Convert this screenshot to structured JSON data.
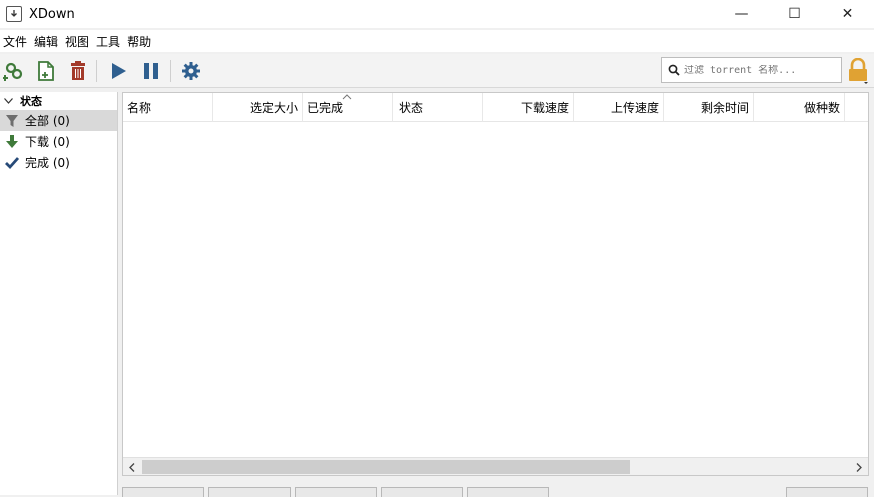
{
  "window": {
    "title": "XDown",
    "minimize": "—",
    "maximize": "☐",
    "close": "✕"
  },
  "menu": [
    "文件",
    "编辑",
    "视图",
    "工具",
    "帮助"
  ],
  "toolbar": {
    "icons": [
      "add-link-icon",
      "add-file-icon",
      "delete-icon",
      "play-icon",
      "pause-icon",
      "settings-icon"
    ]
  },
  "search": {
    "placeholder": "过滤 torrent 名称..."
  },
  "sidebar": {
    "header": "状态",
    "items": [
      {
        "label": "全部 (0)",
        "icon": "filter-icon",
        "selected": true
      },
      {
        "label": "下载 (0)",
        "icon": "download-arrow-icon",
        "selected": false
      },
      {
        "label": "完成 (0)",
        "icon": "checkmark-icon",
        "selected": false
      }
    ]
  },
  "table": {
    "columns": [
      "名称",
      "选定大小",
      "已完成",
      "状态",
      "下载速度",
      "上传速度",
      "剩余时间",
      "做种数"
    ]
  },
  "colors": {
    "accent_green": "#3f7a3a",
    "delete_red": "#a33a2a",
    "play_blue": "#2f5f8f",
    "check_blue": "#274a78",
    "lock_orange": "#e0a233"
  }
}
